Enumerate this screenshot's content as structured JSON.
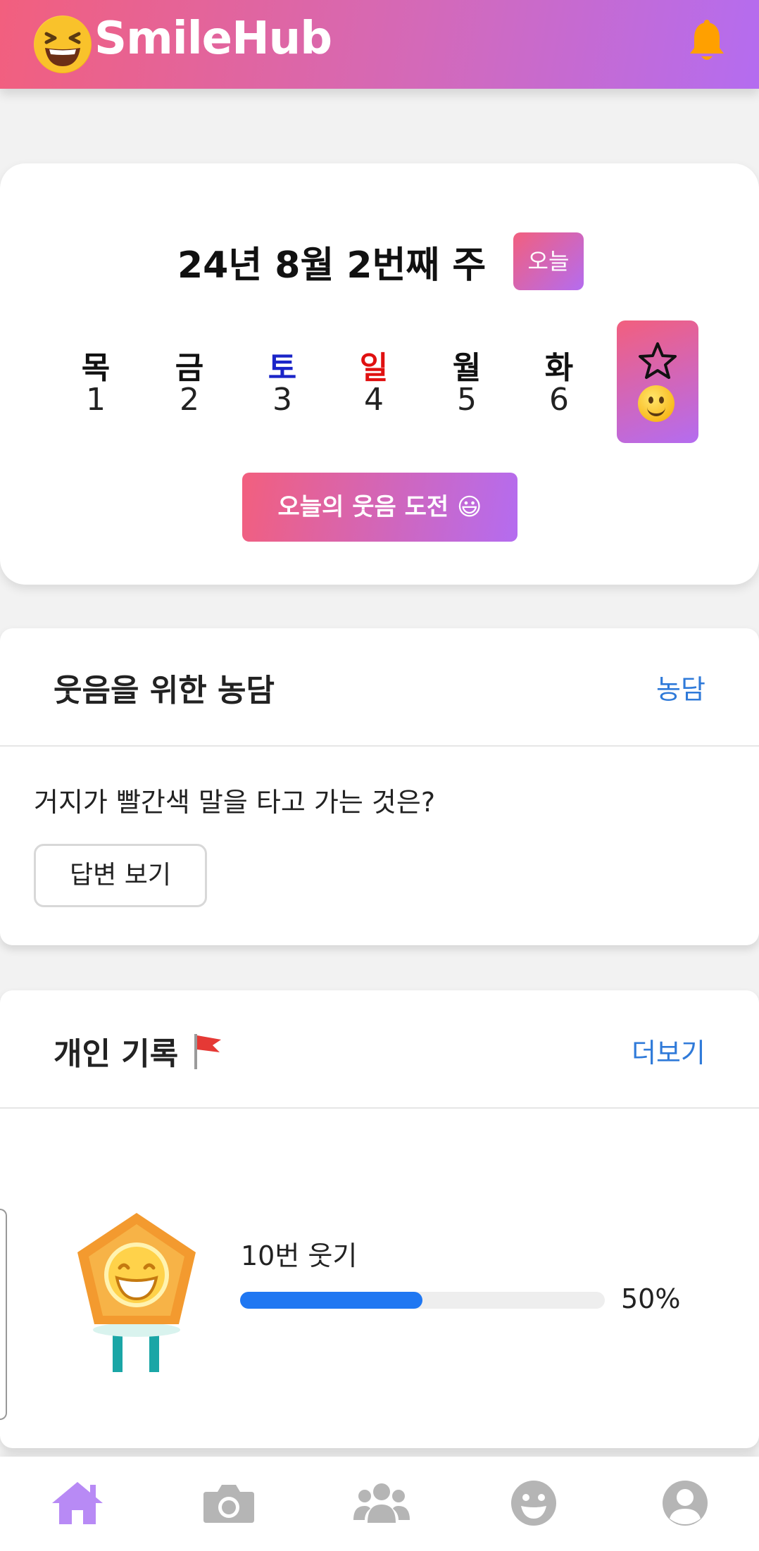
{
  "header": {
    "brand": "SmileHub",
    "logo_icon": "laughing-face-icon",
    "notification_icon": "bell-icon",
    "colors": {
      "gradient_start": "#f25f7e",
      "gradient_end": "#b46cf0",
      "bell": "#ffa000"
    }
  },
  "week": {
    "title": "24년 8월 2번째 주",
    "today_label": "오늘",
    "days": [
      {
        "dow": "목",
        "num": "1",
        "color": "#111111"
      },
      {
        "dow": "금",
        "num": "2",
        "color": "#111111"
      },
      {
        "dow": "토",
        "num": "3",
        "color": "#1a24c8"
      },
      {
        "dow": "일",
        "num": "4",
        "color": "#e01010"
      },
      {
        "dow": "월",
        "num": "5",
        "color": "#111111"
      },
      {
        "dow": "화",
        "num": "6",
        "color": "#111111"
      }
    ],
    "today_day_icons": [
      "star-icon",
      "slightly-smiling-face-icon"
    ],
    "challenge_button": "오늘의 웃음 도전 😃"
  },
  "joke": {
    "title": "웃음을 위한 농담",
    "link": "농담",
    "question": "거지가 빨간색 말을 타고 가는 것은?",
    "answer_button": "답변 보기"
  },
  "record": {
    "title": "개인 기록",
    "title_icon": "red-flag-icon",
    "link": "더보기",
    "badge_icon": "smile-medal-icon",
    "goal_label": "10번 웃기",
    "progress_percent": 50,
    "progress_text": "50%"
  },
  "bottom_nav": {
    "items": [
      "home-icon",
      "camera-icon",
      "friends-icon",
      "smile-icon",
      "profile-icon"
    ],
    "active": "home-icon",
    "colors": {
      "active": "#b88af5",
      "inactive": "#b5b5b5"
    }
  }
}
